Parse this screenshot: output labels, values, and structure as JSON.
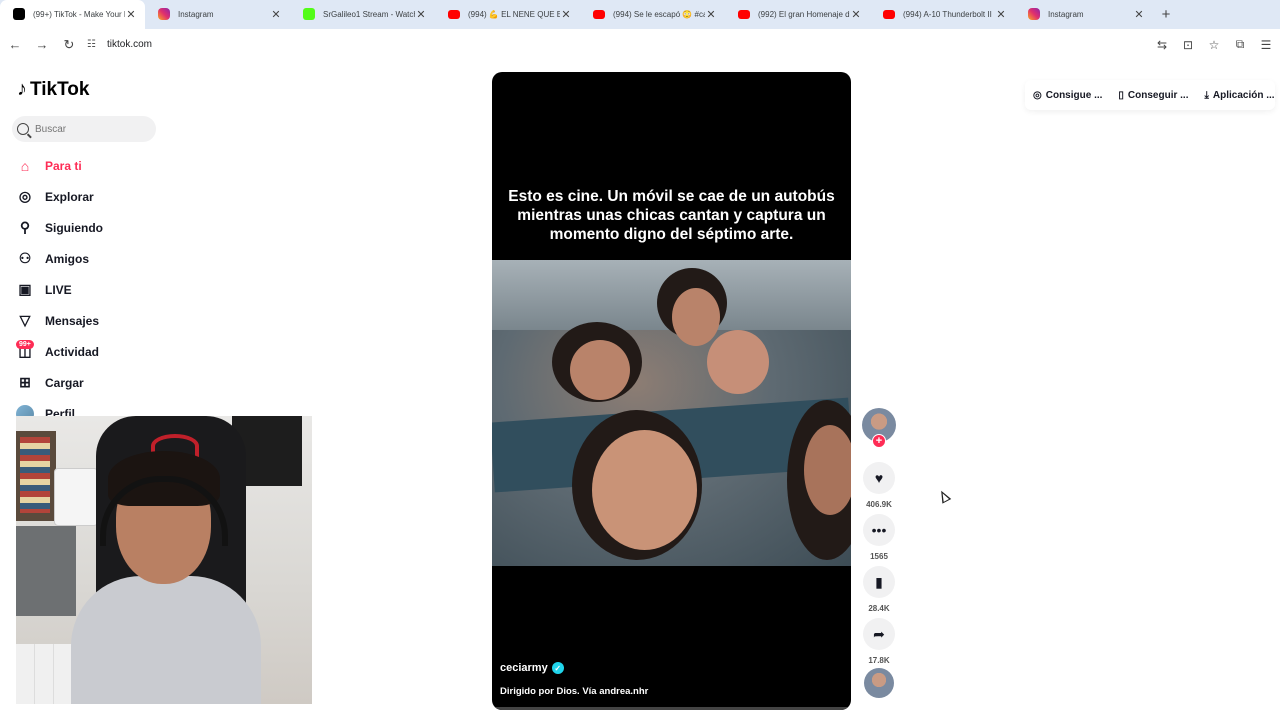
{
  "browser": {
    "tabs": [
      {
        "title": "(99+) TikTok - Make Your D",
        "favicon": "tiktok-icon",
        "active": true
      },
      {
        "title": "Instagram",
        "favicon": "instagram-icon",
        "active": false
      },
      {
        "title": "SrGalileo1 Stream - Watch",
        "favicon": "kick-icon",
        "active": false
      },
      {
        "title": "(994) 💪 EL NENE QUE EN",
        "favicon": "youtube-icon",
        "active": false
      },
      {
        "title": "(994) Se le escapó 😳 #ca",
        "favicon": "youtube-icon",
        "active": false
      },
      {
        "title": "(992) El gran Homenaje d",
        "favicon": "youtube-icon",
        "active": false
      },
      {
        "title": "(994) A-10 Thunderbolt II",
        "favicon": "youtube-icon",
        "active": false
      },
      {
        "title": "Instagram",
        "favicon": "instagram-icon",
        "active": false
      }
    ],
    "address": "tiktok.com"
  },
  "sidebar": {
    "logo": "TikTok",
    "search_placeholder": "Buscar",
    "items": [
      {
        "label": "Para ti",
        "icon": "home-icon"
      },
      {
        "label": "Explorar",
        "icon": "compass-icon"
      },
      {
        "label": "Siguiendo",
        "icon": "following-icon"
      },
      {
        "label": "Amigos",
        "icon": "friends-icon"
      },
      {
        "label": "LIVE",
        "icon": "live-icon"
      },
      {
        "label": "Mensajes",
        "icon": "messages-icon"
      },
      {
        "label": "Actividad",
        "icon": "activity-icon"
      },
      {
        "label": "Cargar",
        "icon": "upload-icon"
      },
      {
        "label": "Perfil",
        "icon": "profile-avatar"
      }
    ],
    "activity_badge": "99+"
  },
  "video": {
    "caption": "Esto es cine. Un móvil se cae de un autobús mientras unas chicas cantan y captura un momento digno del séptimo arte.",
    "author": "ceciarmy",
    "description": "Dirigido por Dios. Vía andrea.nhr"
  },
  "actions": {
    "likes": "406.9K",
    "comments": "1565",
    "saves": "28.4K",
    "shares": "17.8K"
  },
  "top_links": {
    "coins": "Consigue ...",
    "get_app": "Conseguir ...",
    "app": "Aplicación ..."
  },
  "colors": {
    "accent": "#fe2c55",
    "verified": "#20d5ec"
  }
}
